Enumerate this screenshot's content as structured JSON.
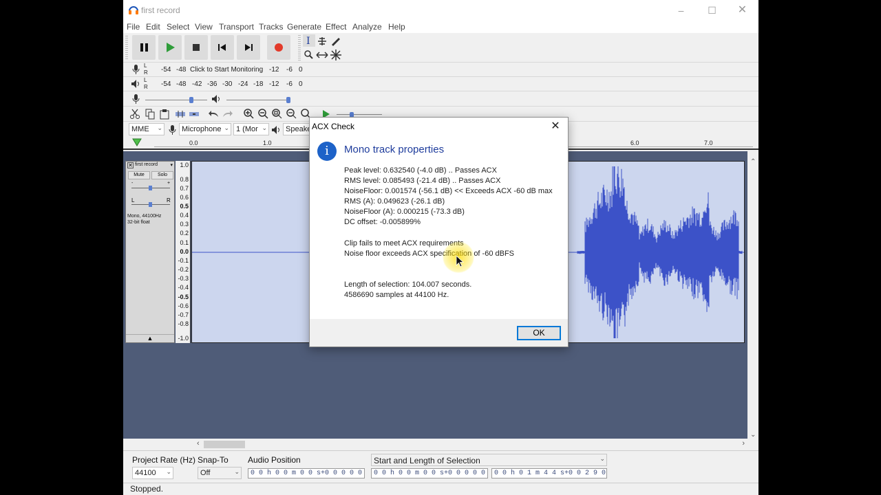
{
  "window": {
    "title": "first record"
  },
  "menu": [
    "File",
    "Edit",
    "Select",
    "View",
    "Transport",
    "Tracks",
    "Generate",
    "Effect",
    "Analyze",
    "Help"
  ],
  "meters": {
    "record_scale": [
      "-54",
      "-48"
    ],
    "record_prompt": "Click to Start Monitoring",
    "record_scale_right": [
      "-12",
      "-6",
      "0"
    ],
    "play_scale": [
      "-54",
      "-48",
      "-42",
      "-36",
      "-30",
      "-24",
      "-18",
      "-12",
      "-6",
      "0"
    ],
    "channel_l": "L",
    "channel_r": "R"
  },
  "device": {
    "host": "MME",
    "input": "Microphone",
    "channels": "1 (Mor",
    "output": "Speake"
  },
  "ruler": {
    "ticks": [
      {
        "label": "0.0"
      },
      {
        "label": "1.0"
      },
      {
        "label": "6.0"
      },
      {
        "label": "7.0"
      }
    ]
  },
  "track": {
    "name": "first record",
    "mute": "Mute",
    "solo": "Solo",
    "pan_l": "L",
    "pan_r": "R",
    "info1": "Mono, 44100Hz",
    "info2": "32-bit float",
    "scale": [
      "1.0",
      "0.8",
      "0.7",
      "0.6",
      "0.5",
      "0.4",
      "0.3",
      "0.2",
      "0.1",
      "0.0",
      "-0.1",
      "-0.2",
      "-0.3",
      "-0.4",
      "-0.5",
      "-0.6",
      "-0.7",
      "-0.8",
      "-1.0"
    ]
  },
  "dialog": {
    "title": "ACX Check",
    "heading": "Mono track properties",
    "lines": [
      "Peak level: 0.632540 (-4.0 dB)  .. Passes ACX",
      "RMS level: 0.085493 (-21.4 dB)  .. Passes ACX",
      "NoiseFloor: 0.001574 (-56.1 dB)  << Exceeds ACX -60 dB max",
      "RMS (A): 0.049623 (-26.1 dB)",
      "NoiseFloor (A): 0.000215 (-73.3 dB)",
      "DC offset: -0.005899%",
      "Clip fails to meet ACX requirements",
      "Noise floor exceeds ACX specification of -60 dBFS",
      "Length of selection: 104.007 seconds.",
      "4586690 samples at 44100 Hz."
    ],
    "ok": "OK"
  },
  "bottom": {
    "rate_label": "Project Rate (Hz)",
    "rate_value": "44100",
    "snap_label": "Snap-To",
    "snap_value": "Off",
    "audio_pos_label": "Audio Position",
    "audio_pos_value": "0 0 h 0 0 m 0 0 s+0 0 0 0 0 samples",
    "selection_label": "Start and Length of Selection",
    "sel_start_value": "0 0 h 0 0 m 0 0 s+0 0 0 0 0 samples",
    "sel_length_value": "0 0 h 0 1 m 4 4 s+0 0 2 9 0 samples"
  },
  "status": "Stopped.",
  "colors": {
    "accent": "#0078d7",
    "record": "#e33a2a",
    "play": "#2f9d3a",
    "waveform": "#3c52c8",
    "track_bg": "#ccd6ee"
  }
}
